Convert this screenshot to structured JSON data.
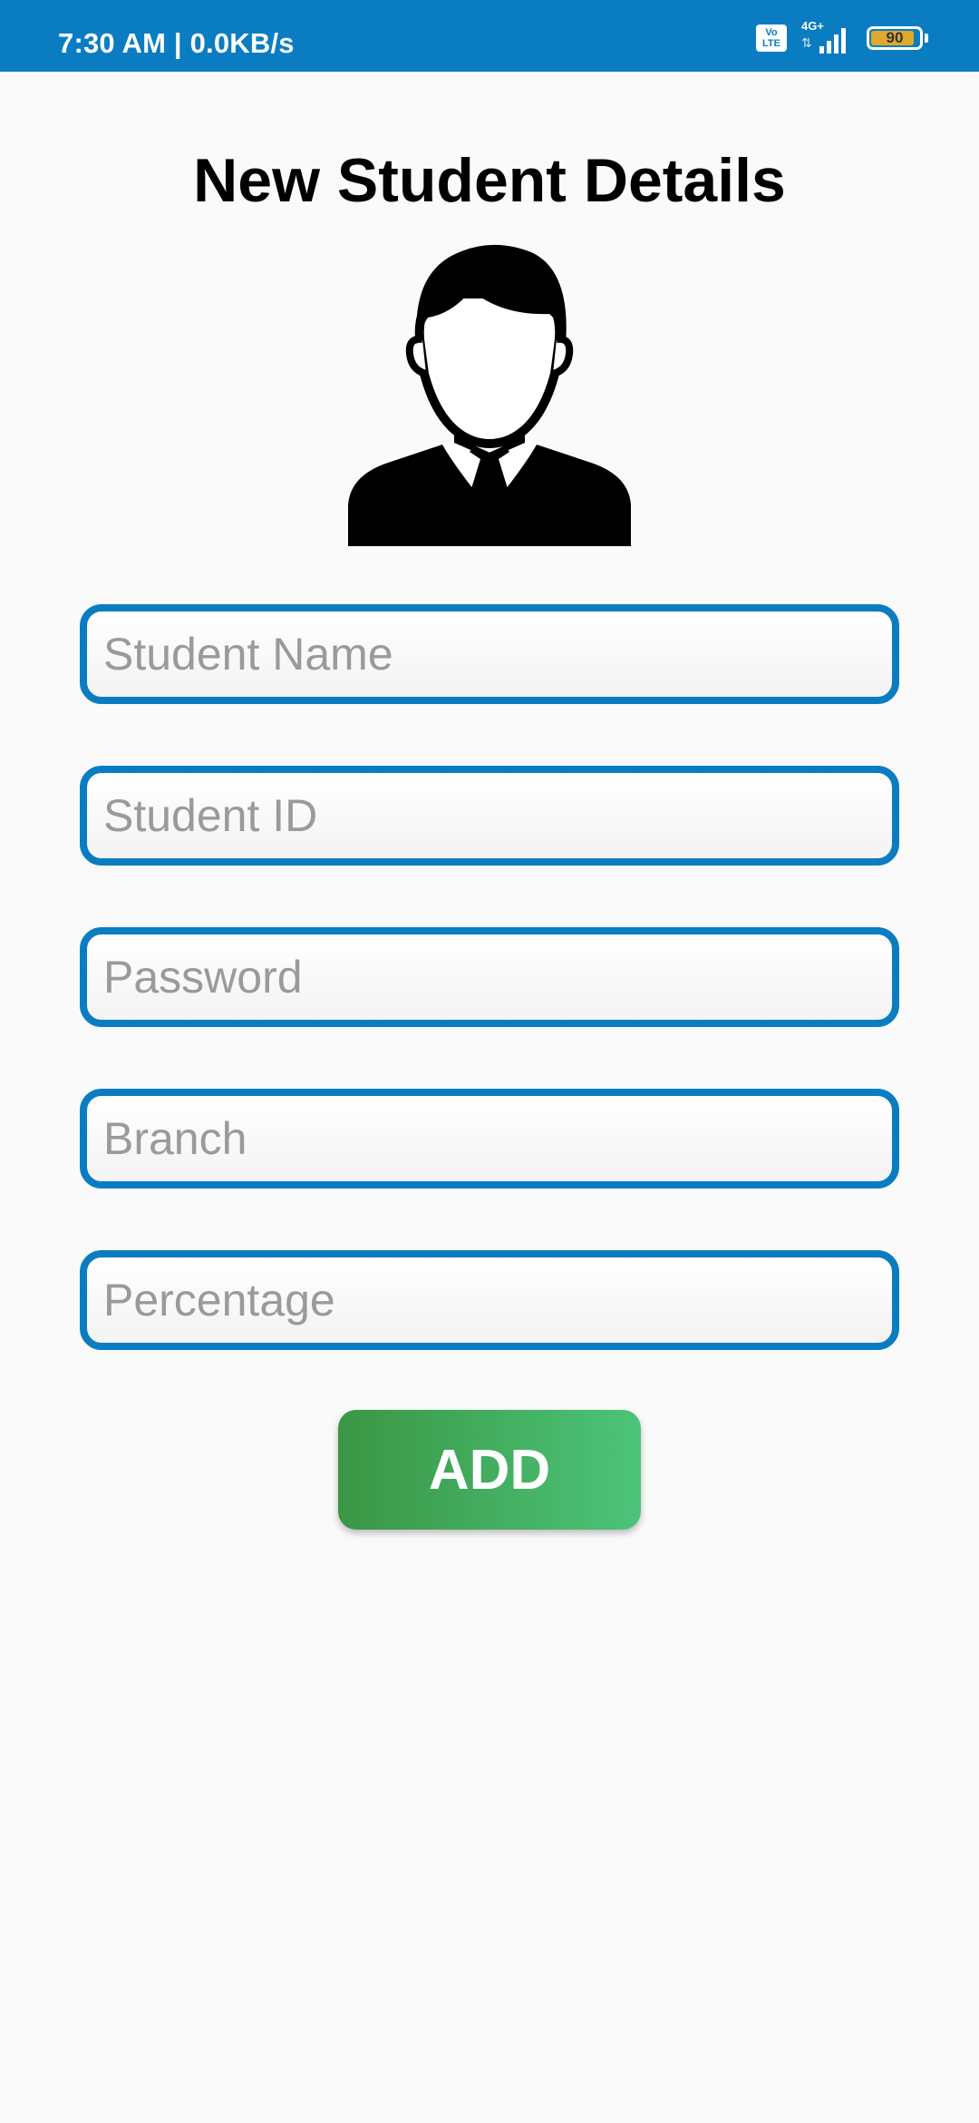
{
  "status_bar": {
    "time_speed": "7:30 AM | 0.0KB/s",
    "volte_top": "Vo",
    "volte_bottom": "LTE",
    "network": "4G+",
    "battery": "90",
    "battery_level": 0.9,
    "background_color": "#0a7dc2"
  },
  "page": {
    "title": "New Student Details",
    "avatar_icon": "person-with-tie-icon"
  },
  "form": {
    "fields": [
      {
        "placeholder": "Student Name",
        "value": ""
      },
      {
        "placeholder": "Student ID",
        "value": ""
      },
      {
        "placeholder": "Password",
        "value": ""
      },
      {
        "placeholder": "Branch",
        "value": ""
      },
      {
        "placeholder": "Percentage",
        "value": ""
      }
    ],
    "add_label": "ADD",
    "field_border_color": "#0a7dc2",
    "button_color": "#4cc47a"
  }
}
